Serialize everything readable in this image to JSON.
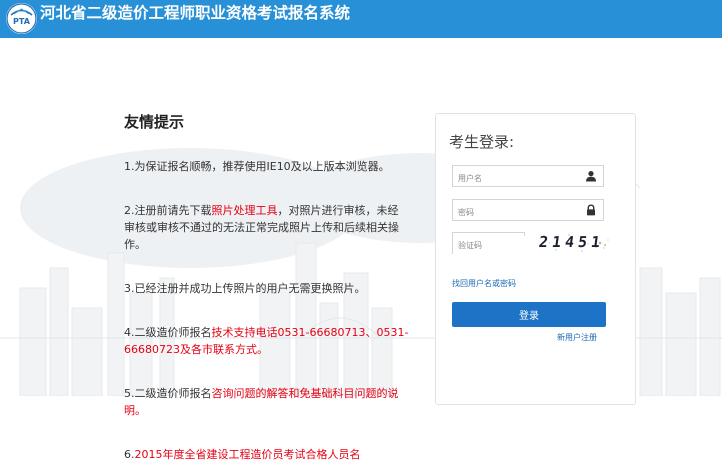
{
  "header": {
    "title": "河北省二级造价工程师职业资格考试报名系统",
    "logo_text": "PTA",
    "bg_color": "#2790d6"
  },
  "tips": {
    "title": "友情提示",
    "items": [
      {
        "parts": [
          "1.为保证报名顺畅，推荐使用IE10及以上版本浏览器。"
        ]
      },
      {
        "parts": [
          "2.注册前请先下载",
          "照片处理工具",
          "，对照片进行审核，未经审核或审核不通过的无法正常完成照片上传和后续相关操作。"
        ]
      },
      {
        "parts": [
          "3.已经注册并成功上传照片的用户无需更换照片。"
        ]
      },
      {
        "parts": [
          "4.二级造价师报名",
          "技术支持电话0531-66680713、0531-66680723及各市联系方式。"
        ]
      },
      {
        "parts": [
          "5.二级造价师报名",
          "咨询问题的解答和免基础科目问题的说明。"
        ]
      },
      {
        "parts": [
          "6.",
          "2015年度全省建设工程造价员考试合格人员名"
        ]
      }
    ]
  },
  "login": {
    "title": "考生登录:",
    "username_placeholder": "用户名",
    "password_placeholder": "密码",
    "captcha_placeholder": "验证码",
    "captcha_value": "21451",
    "recover_link": "找回用户名或密码",
    "submit_label": "登录",
    "register_link": "新用户注册",
    "accent_color": "#1d74c7"
  }
}
